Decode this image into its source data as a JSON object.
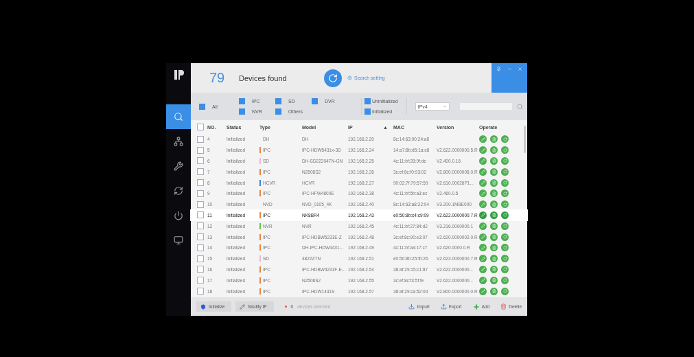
{
  "header": {
    "count": "79",
    "title": "Devices found",
    "search_setting": "Search setting"
  },
  "sidebar": {
    "items": [
      {
        "kind": "search",
        "selected": true
      },
      {
        "kind": "network",
        "selected": false
      },
      {
        "kind": "tools",
        "selected": false
      },
      {
        "kind": "update",
        "selected": false
      },
      {
        "kind": "power",
        "selected": false
      },
      {
        "kind": "display",
        "selected": false
      }
    ]
  },
  "filters": {
    "types": [
      {
        "label": "All",
        "checked": true
      },
      {
        "label": "IPC",
        "checked": true
      },
      {
        "label": "SD",
        "checked": true
      },
      {
        "label": "DVR",
        "checked": true
      },
      {
        "label": "NVR",
        "checked": true
      },
      {
        "label": "Others",
        "checked": true
      }
    ],
    "states": [
      {
        "label": "Uninitialized",
        "checked": true
      },
      {
        "label": "Initialized",
        "checked": true
      }
    ],
    "ip_version": "IPv4"
  },
  "table": {
    "columns": [
      "NO.",
      "Status",
      "Type",
      "Model",
      "IP",
      "MAC",
      "Version",
      "Operate"
    ],
    "sort_indicator": "▲",
    "all_checked": false,
    "rows": [
      {
        "no": "4",
        "status": "Initialized",
        "type": "DH",
        "model": "DH",
        "ip": "192.168.2.20",
        "mac": "8c:14:63:90:24:a8",
        "version": "",
        "checked": false,
        "selected": false
      },
      {
        "no": "5",
        "status": "Initialized",
        "type": "IPC",
        "color": "#e8863a",
        "model": "IPC-HDW5431x-3D",
        "ip": "192.168.2.24",
        "mac": "14:a7:8b:d5:1a:e8",
        "version": "V2.622.0000000.5.R",
        "checked": false,
        "selected": false
      },
      {
        "no": "6",
        "status": "Initialized",
        "type": "SD",
        "color": "#f0b8c8",
        "model": "DH-SD22204TN-GN",
        "ip": "192.168.2.25",
        "mac": "4c:11:bf:28:9f:de",
        "version": "V2.400.0.16",
        "checked": false,
        "selected": false
      },
      {
        "no": "7",
        "status": "Initialized",
        "type": "IPC",
        "color": "#e8863a",
        "model": "N2508S2",
        "ip": "192.168.2.26",
        "mac": "3c:ef:8c:f0:93:02",
        "version": "V2.800.0000008.0.R",
        "checked": false,
        "selected": false
      },
      {
        "no": "8",
        "status": "Initialized",
        "type": "HCVR",
        "color": "#3b82d6",
        "model": "HCVR",
        "ip": "192.168.2.27",
        "mac": "90:02:7f:79:57:59",
        "version": "V2.610.00026P1...",
        "checked": false,
        "selected": false
      },
      {
        "no": "9",
        "status": "Initialized",
        "type": "IPC",
        "color": "#e8863a",
        "model": "IPC-HFW4800E",
        "ip": "192.168.2.38",
        "mac": "4c:11:bf:5b:a3:ec",
        "version": "V2.460.0.5",
        "checked": false,
        "selected": false
      },
      {
        "no": "10",
        "status": "Initialized",
        "type": "NVD",
        "model": "NVD_0105_4K",
        "ip": "192.168.2.40",
        "mac": "8c:14:63:a8:22:94",
        "version": "V3.200.1MBE000",
        "checked": false,
        "selected": false
      },
      {
        "no": "11",
        "status": "Initialized",
        "type": "IPC",
        "color": "#e8863a",
        "model": "NK8BR4",
        "ip": "192.168.2.43",
        "mac": "e0:50:8b:c4:c9:09",
        "version": "V2.622.0000000.7.R",
        "checked": false,
        "selected": true
      },
      {
        "no": "12",
        "status": "Initialized",
        "type": "NVR",
        "color": "#6cc04a",
        "model": "NVR",
        "ip": "192.168.2.45",
        "mac": "4c:11:bf:27:84:d2",
        "version": "V3.216.0000000.1",
        "checked": false,
        "selected": false
      },
      {
        "no": "13",
        "status": "Initialized",
        "type": "IPC",
        "color": "#e8863a",
        "model": "IPC-HDBW5231E-Z",
        "ip": "192.168.2.48",
        "mac": "3c:ef:8c:90:e3:07",
        "version": "V2.620.0000002.0.R",
        "checked": false,
        "selected": false
      },
      {
        "no": "14",
        "status": "Initialized",
        "type": "IPC",
        "color": "#e8863a",
        "model": "DH-IPC-HDW4431...",
        "ip": "192.168.2.49",
        "mac": "4c:11:bf:aa:17:c7",
        "version": "V2.620.0000.0.R",
        "checked": false,
        "selected": false
      },
      {
        "no": "15",
        "status": "Initialized",
        "type": "SD",
        "color": "#f0b8c8",
        "model": "4822ZTN",
        "ip": "192.168.2.51",
        "mac": "e0:50:8b:25:fb:26",
        "version": "V2.623.0000000.7.R",
        "checked": false,
        "selected": false
      },
      {
        "no": "16",
        "status": "Initialized",
        "type": "IPC",
        "color": "#e8863a",
        "model": "IPC-HDBW4231F-E...",
        "ip": "192.168.2.54",
        "mac": "38:af:29:15:c1:87",
        "version": "V2.622.0000000...",
        "checked": false,
        "selected": false
      },
      {
        "no": "17",
        "status": "Initialized",
        "type": "IPC",
        "color": "#e8863a",
        "model": "N2508S2",
        "ip": "192.168.2.55",
        "mac": "3c:ef:8c:f3:5f:fe",
        "version": "V2.622.0000000...",
        "checked": false,
        "selected": false
      },
      {
        "no": "18",
        "status": "Initialized",
        "type": "IPC",
        "color": "#e8863a",
        "model": "IPC-HDW1431S",
        "ip": "192.168.2.57",
        "mac": "38:af:29:ca:52:0d",
        "version": "V2.800.0000000.0.R",
        "checked": false,
        "selected": false
      }
    ]
  },
  "footer": {
    "initialize": "Initialize",
    "modify_ip": "Modify IP",
    "selected_count": "0",
    "selected_label": "devices selected",
    "import": "Import",
    "export": "Export",
    "add": "Add",
    "delete": "Delete"
  }
}
